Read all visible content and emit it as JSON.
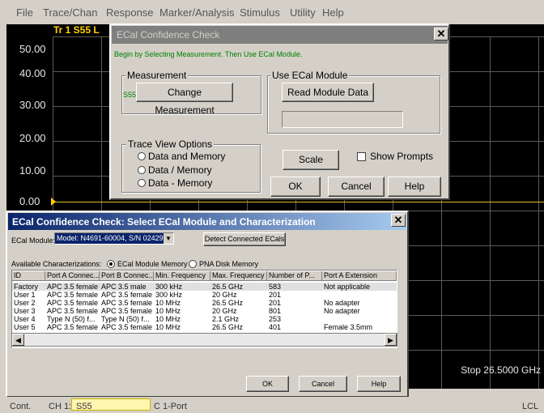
{
  "menu": [
    "File",
    "Trace/Chan",
    "Response",
    "Marker/Analysis",
    "Stimulus",
    "Utility",
    "Help"
  ],
  "plot": {
    "trace_title": "Tr 1  S55 L",
    "y_labels": [
      "50.00",
      "40.00",
      "30.00",
      "20.00",
      "10.00",
      "0.00"
    ],
    "stop_label": "Stop  26.5000 GHz",
    "trace_color": "#ffd200"
  },
  "status": {
    "mode": "Cont.",
    "channel": "CH 1:",
    "measurement": "S55",
    "cal": "C  1-Port",
    "remote": "LCL"
  },
  "confidence": {
    "title": "ECal Confidence Check",
    "instruction": "Begin by Selecting Measurement.  Then Use ECal Module.",
    "measurement_group": "Measurement",
    "measurement_hint": "S55",
    "change_measurement": "Change Measurement",
    "use_ecal_group": "Use ECal Module",
    "read_module_data": "Read Module Data",
    "trace_view_group": "Trace View Options",
    "trace_options": [
      {
        "label": "Data and Memory",
        "checked": false
      },
      {
        "label": "Data / Memory",
        "checked": false
      },
      {
        "label": "Data - Memory",
        "checked": false
      }
    ],
    "scale": "Scale",
    "show_prompts": "Show Prompts",
    "show_prompts_checked": false,
    "ok": "OK",
    "cancel": "Cancel",
    "help": "Help"
  },
  "select": {
    "title": "ECal Confidence Check: Select ECal Module and Characterization",
    "module_label": "ECal Module:",
    "module_value": "Model: N4691-60004, S/N 02429",
    "detect": "Detect Connected ECals",
    "available_label": "Available Characterizations:",
    "source_options": [
      {
        "label": "ECal Module Memory",
        "checked": true
      },
      {
        "label": "PNA Disk Memory",
        "checked": false
      }
    ],
    "columns": [
      "ID",
      "Port A Connec...",
      "Port B Connec...",
      "Min. Frequency",
      "Max. Frequency",
      "Number of P...",
      "Port A Extension"
    ],
    "rows": [
      [
        "Factory",
        "APC 3.5 female",
        "APC 3.5 male",
        "300 kHz",
        "26.5 GHz",
        "583",
        "Not applicable"
      ],
      [
        "User 1",
        "APC 3.5 female",
        "APC 3.5 female",
        "300 kHz",
        "20 GHz",
        "201",
        ""
      ],
      [
        "User 2",
        "APC 3.5 female",
        "APC 3.5 female",
        "10 MHz",
        "26.5 GHz",
        "201",
        "No adapter"
      ],
      [
        "User 3",
        "APC 3.5 female",
        "APC 3.5 female",
        "10 MHz",
        "20 GHz",
        "801",
        "No adapter"
      ],
      [
        "User 4",
        "Type N (50) f...",
        "Type N (50) f...",
        "10 MHz",
        "2.1 GHz",
        "253",
        ""
      ],
      [
        "User 5",
        "APC 3.5 female",
        "APC 3.5 female",
        "10 MHz",
        "26.5 GHz",
        "401",
        "Female 3.5mm"
      ]
    ],
    "selected_row": 0,
    "ok": "OK",
    "cancel": "Cancel",
    "help": "Help"
  },
  "colors": {
    "titlebar_active": "#0a246a",
    "titlebar_inactive": "#7f7f7f",
    "instruction_text": "#008000",
    "plot_background": "#000000"
  }
}
